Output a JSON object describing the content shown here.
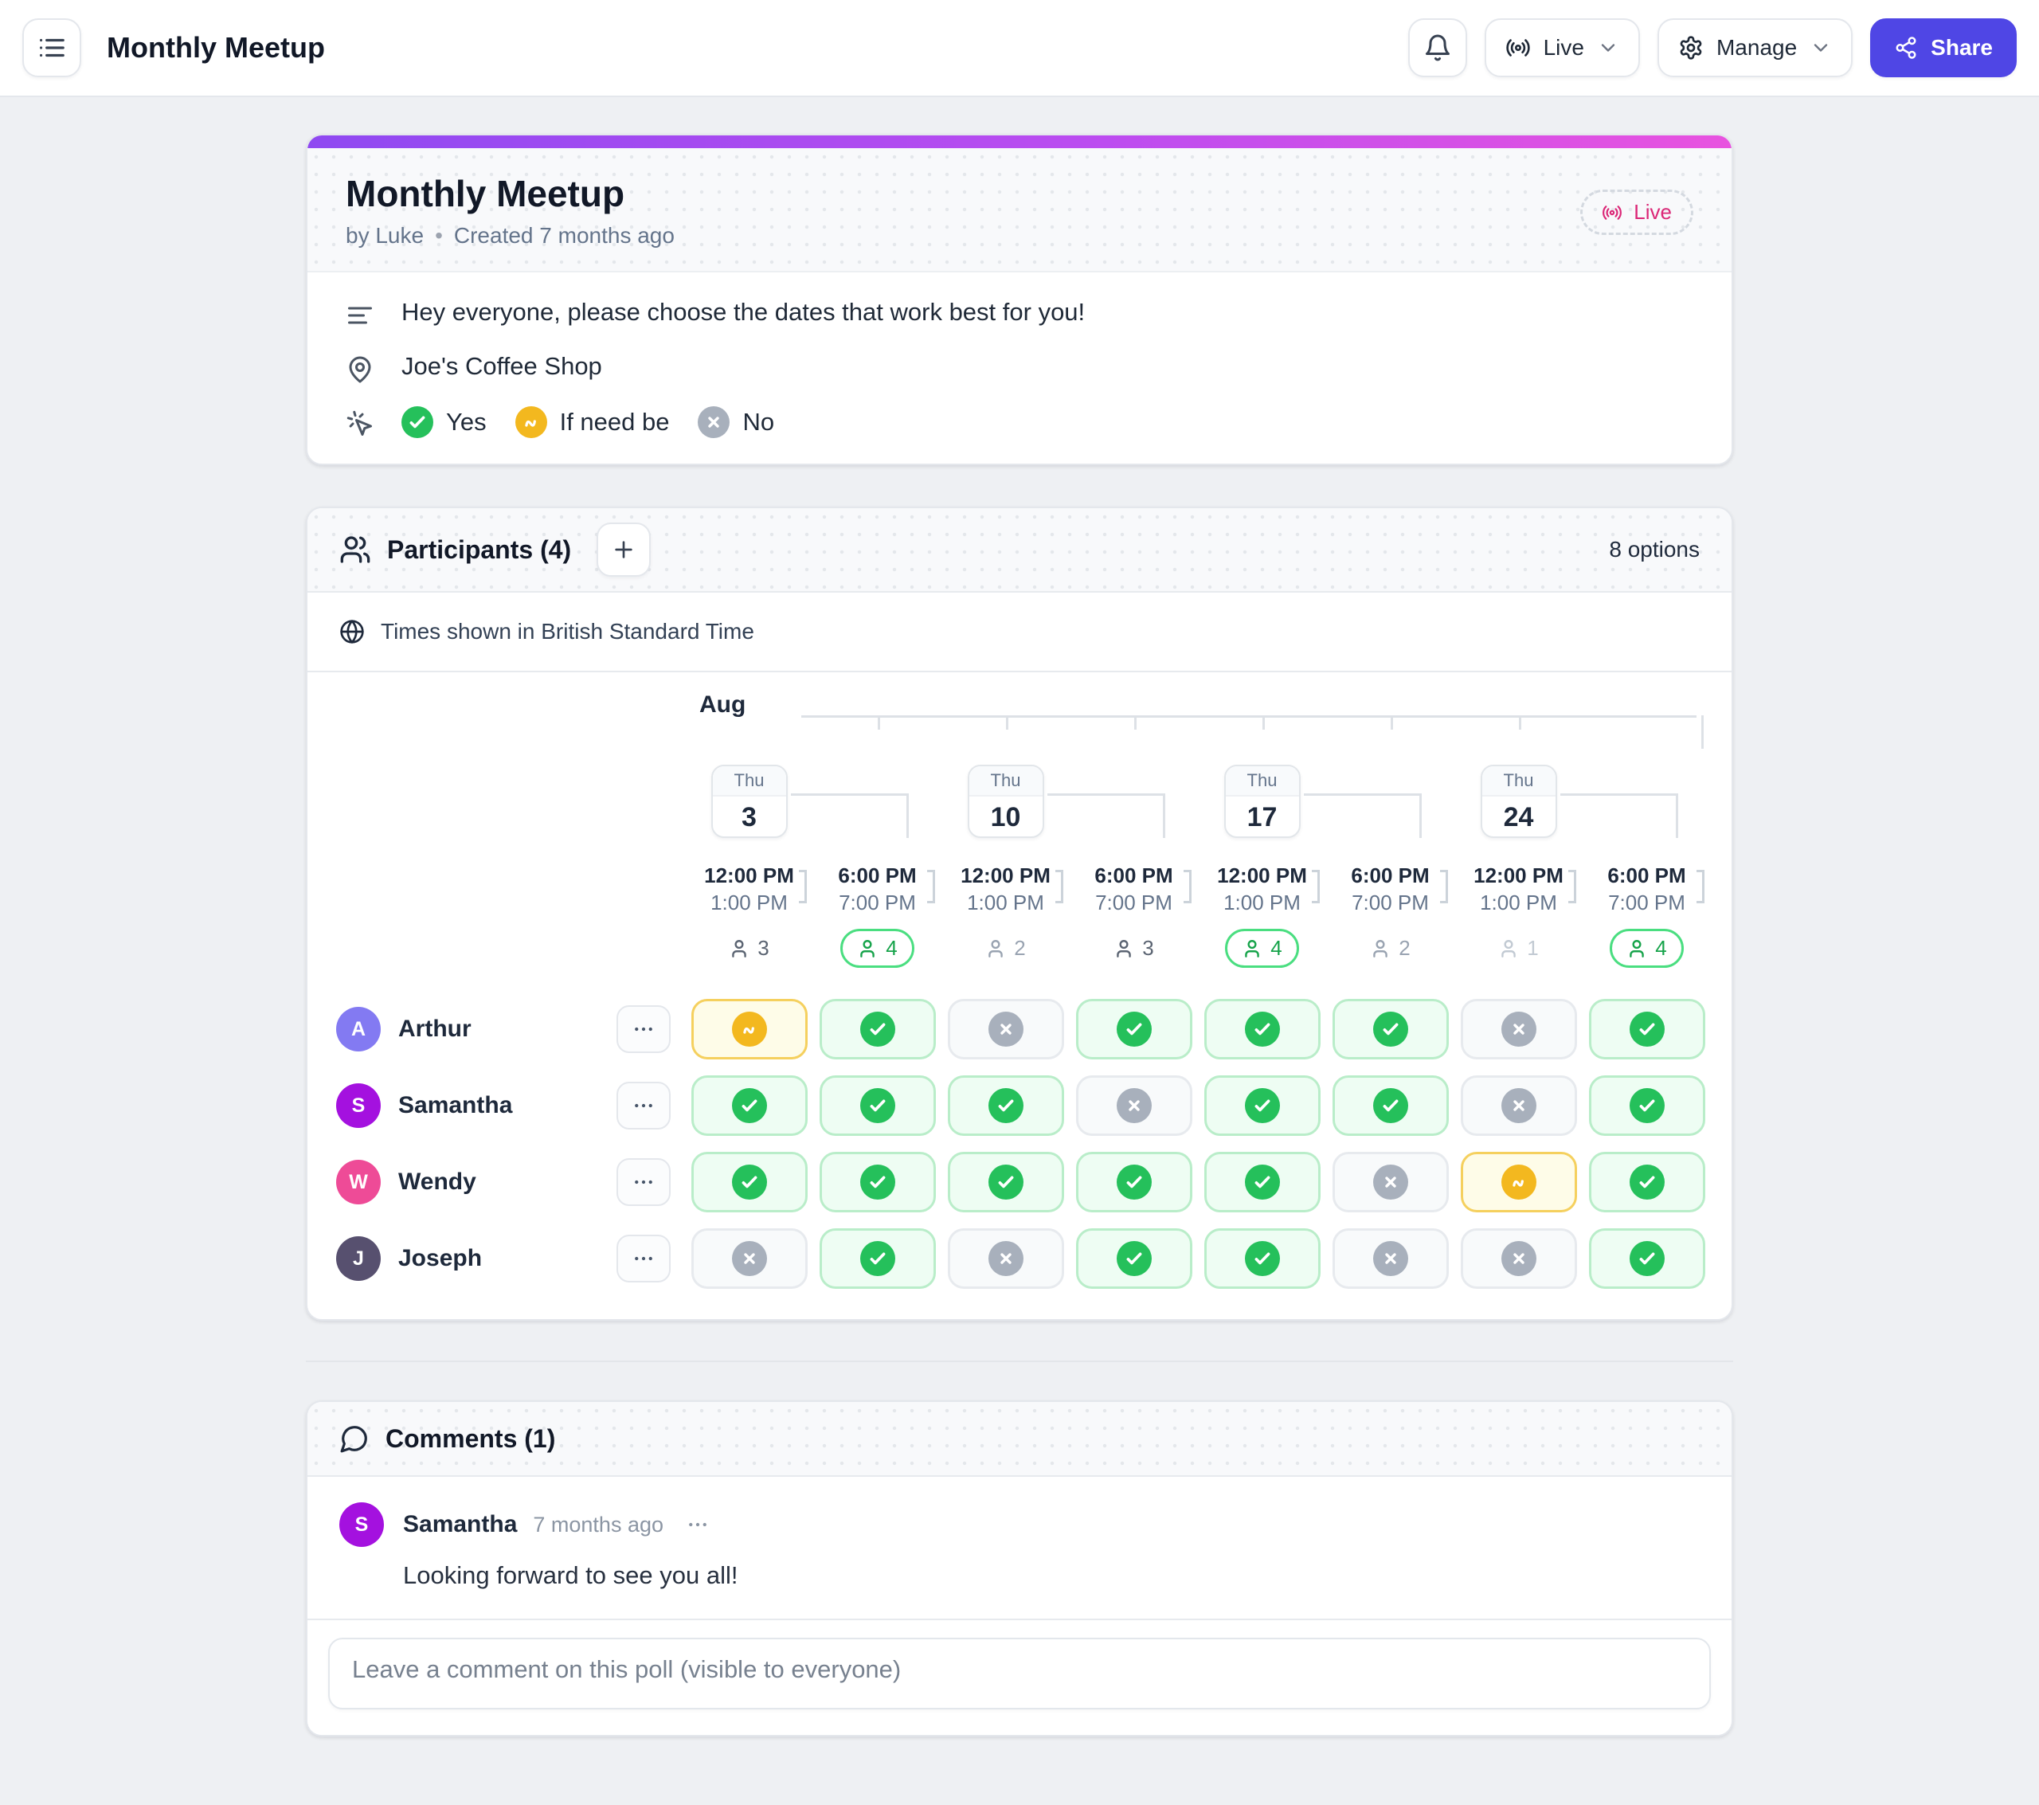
{
  "topbar": {
    "title": "Monthly Meetup",
    "live_label": "Live",
    "manage_label": "Manage",
    "share_label": "Share"
  },
  "poll": {
    "title": "Monthly Meetup",
    "byline": "by Luke",
    "dot": "•",
    "created": "Created 7 months ago",
    "live_badge": "Live",
    "description": "Hey everyone, please choose the dates that work best for you!",
    "location": "Joe's Coffee Shop",
    "legend": [
      {
        "type": "yes",
        "label": "Yes"
      },
      {
        "type": "ifneedbe",
        "label": "If need be"
      },
      {
        "type": "no",
        "label": "No"
      }
    ]
  },
  "participants_section": {
    "title": "Participants (4)",
    "options_label": "8 options",
    "timezone": "Times shown in British Standard Time",
    "month": "Aug",
    "dates": [
      {
        "dow": "Thu",
        "day": "3"
      },
      {
        "dow": "Thu",
        "day": "10"
      },
      {
        "dow": "Thu",
        "day": "17"
      },
      {
        "dow": "Thu",
        "day": "24"
      }
    ],
    "slots": [
      {
        "start": "12:00 PM",
        "end": "1:00 PM"
      },
      {
        "start": "6:00 PM",
        "end": "7:00 PM"
      },
      {
        "start": "12:00 PM",
        "end": "1:00 PM"
      },
      {
        "start": "6:00 PM",
        "end": "7:00 PM"
      },
      {
        "start": "12:00 PM",
        "end": "1:00 PM"
      },
      {
        "start": "6:00 PM",
        "end": "7:00 PM"
      },
      {
        "start": "12:00 PM",
        "end": "1:00 PM"
      },
      {
        "start": "6:00 PM",
        "end": "7:00 PM"
      }
    ],
    "counts": [
      {
        "value": 3,
        "emphasis": "mid"
      },
      {
        "value": 4,
        "emphasis": "best"
      },
      {
        "value": 2,
        "emphasis": "low"
      },
      {
        "value": 3,
        "emphasis": "mid"
      },
      {
        "value": 4,
        "emphasis": "best"
      },
      {
        "value": 2,
        "emphasis": "low"
      },
      {
        "value": 1,
        "emphasis": "faint"
      },
      {
        "value": 4,
        "emphasis": "best"
      }
    ],
    "participants": [
      {
        "name": "Arthur",
        "initial": "A",
        "color": "#837af2",
        "votes": [
          "ifneedbe",
          "yes",
          "no",
          "yes",
          "yes",
          "yes",
          "no",
          "yes"
        ]
      },
      {
        "name": "Samantha",
        "initial": "S",
        "color": "#a411df",
        "votes": [
          "yes",
          "yes",
          "yes",
          "no",
          "yes",
          "yes",
          "no",
          "yes"
        ]
      },
      {
        "name": "Wendy",
        "initial": "W",
        "color": "#ee4b97",
        "votes": [
          "yes",
          "yes",
          "yes",
          "yes",
          "yes",
          "no",
          "ifneedbe",
          "yes"
        ]
      },
      {
        "name": "Joseph",
        "initial": "J",
        "color": "#57506f",
        "votes": [
          "no",
          "yes",
          "no",
          "yes",
          "yes",
          "no",
          "no",
          "yes"
        ]
      }
    ]
  },
  "comments": {
    "title": "Comments (1)",
    "items": [
      {
        "author": "Samantha",
        "initial": "S",
        "color": "#a411df",
        "time": "7 months ago",
        "text": "Looking forward to see you all!"
      }
    ],
    "input_placeholder": "Leave a comment on this poll (visible to everyone)"
  },
  "colors": {
    "accent": "#4f46e5",
    "live": "#db2777",
    "yes": "#25c05b",
    "ifneedbe": "#f3b81f",
    "no": "#a8b0bc",
    "gradient_start": "#8f49f1",
    "gradient_end": "#e853df"
  }
}
